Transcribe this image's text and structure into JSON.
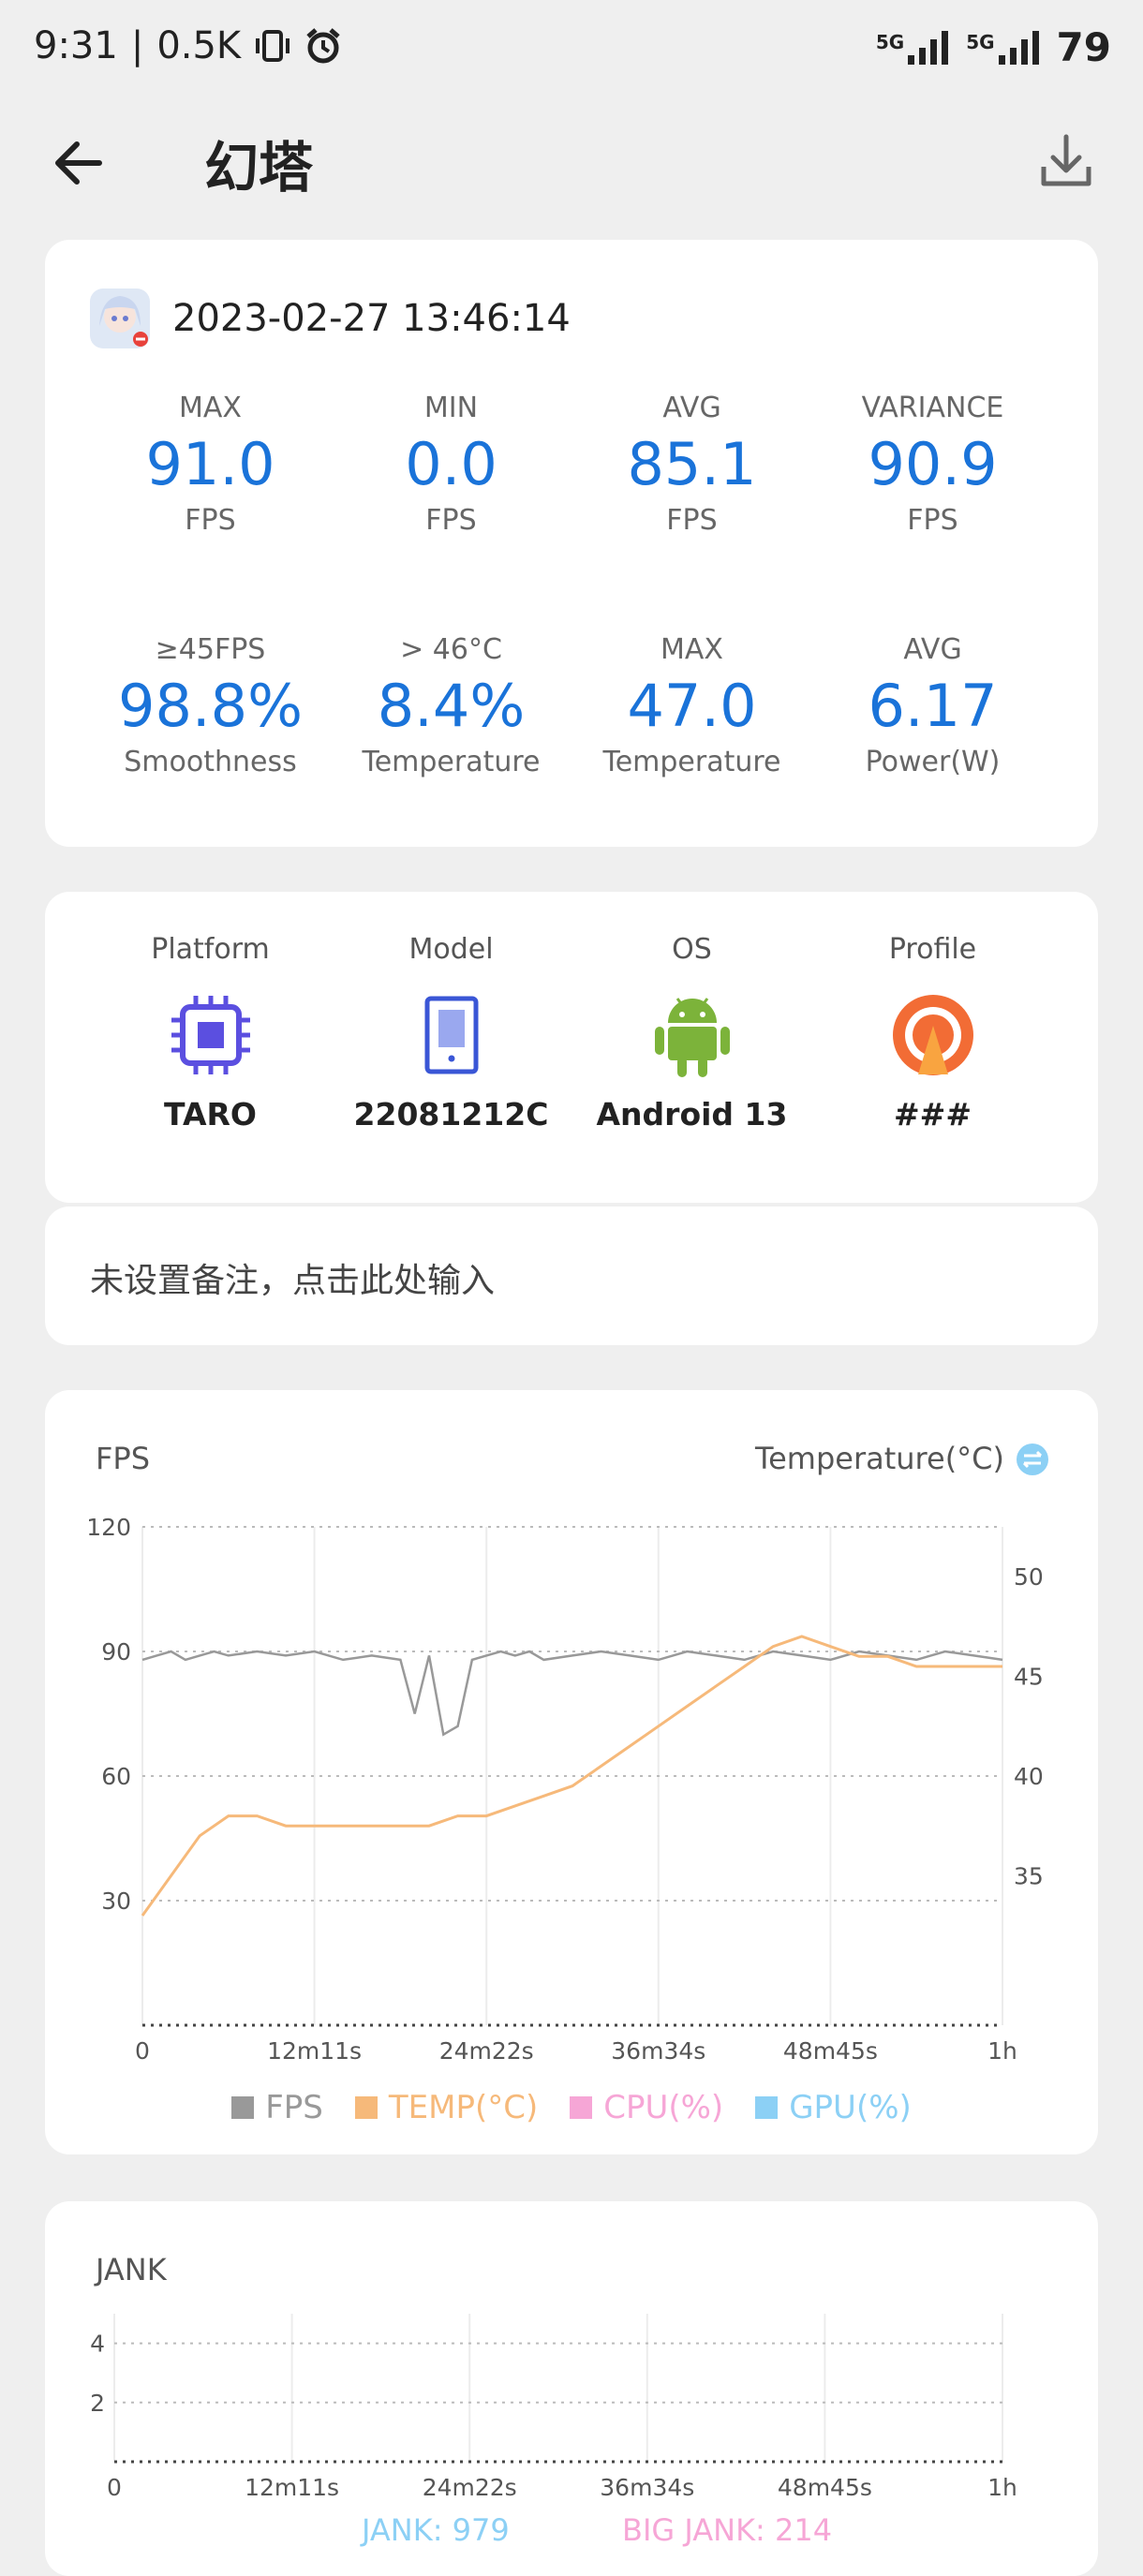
{
  "status": {
    "time": "9:31",
    "speed": "0.5K",
    "signal1": "5G",
    "signal2": "5G",
    "battery": "79"
  },
  "appbar": {
    "title": "幻塔"
  },
  "session": {
    "timestamp": "2023-02-27 13:46:14"
  },
  "stats": [
    {
      "label": "MAX",
      "value": "91.0",
      "unit": "FPS"
    },
    {
      "label": "MIN",
      "value": "0.0",
      "unit": "FPS"
    },
    {
      "label": "AVG",
      "value": "85.1",
      "unit": "FPS"
    },
    {
      "label": "VARIANCE",
      "value": "90.9",
      "unit": "FPS"
    },
    {
      "label": "≥45FPS",
      "value": "98.8%",
      "unit": "Smoothness"
    },
    {
      "label": "> 46°C",
      "value": "8.4%",
      "unit": "Temperature"
    },
    {
      "label": "MAX",
      "value": "47.0",
      "unit": "Temperature"
    },
    {
      "label": "AVG",
      "value": "6.17",
      "unit": "Power(W)"
    }
  ],
  "device": [
    {
      "label": "Platform",
      "value": "TARO",
      "icon": "chip-icon"
    },
    {
      "label": "Model",
      "value": "22081212C",
      "icon": "phone-icon"
    },
    {
      "label": "OS",
      "value": "Android 13",
      "icon": "android-icon"
    },
    {
      "label": "Profile",
      "value": "###",
      "icon": "profile-icon"
    }
  ],
  "note": {
    "placeholder": "未设置备注，点击此处输入"
  },
  "colors": {
    "accent": "#1a73d9",
    "fps": "#999999",
    "temp": "#f6b97a",
    "cpu": "#f6a6d6",
    "gpu": "#8cd0f5"
  },
  "fps_chart": {
    "title": "FPS",
    "right_title": "Temperature(°C)",
    "legend": [
      "FPS",
      "TEMP(°C)",
      "CPU(%)",
      "GPU(%)"
    ]
  },
  "jank_chart": {
    "title": "JANK",
    "jank_label": "JANK: 979",
    "big_jank_label": "BIG JANK: 214"
  },
  "chart_data": [
    {
      "type": "line",
      "title": "FPS",
      "xlabel": "",
      "ylabel": "FPS",
      "x_ticks": [
        "0",
        "12m11s",
        "24m22s",
        "36m34s",
        "48m45s",
        "1h"
      ],
      "xlim_minutes": [
        0,
        60
      ],
      "ylim": [
        0,
        120
      ],
      "y_ticks": [
        30,
        60,
        90,
        120
      ],
      "y2_label": "Temperature(°C)",
      "y2_ticks": [
        35,
        40,
        45,
        50
      ],
      "grid": true,
      "legend_position": "bottom",
      "series": [
        {
          "name": "FPS",
          "axis": "left",
          "x": [
            0,
            1,
            2,
            3,
            4,
            5,
            6,
            8,
            10,
            12,
            14,
            16,
            18,
            19,
            20,
            21,
            22,
            23,
            24,
            25,
            26,
            27,
            28,
            30,
            32,
            34,
            36,
            38,
            40,
            42,
            44,
            46,
            48,
            50,
            52,
            54,
            56,
            58,
            60
          ],
          "y": [
            88,
            89,
            90,
            88,
            89,
            90,
            89,
            90,
            89,
            90,
            88,
            89,
            88,
            75,
            89,
            70,
            72,
            88,
            89,
            90,
            89,
            90,
            88,
            89,
            90,
            89,
            88,
            90,
            89,
            88,
            90,
            89,
            88,
            90,
            89,
            88,
            90,
            89,
            88
          ]
        },
        {
          "name": "TEMP(°C)",
          "axis": "right",
          "x": [
            0,
            2,
            4,
            6,
            8,
            10,
            12,
            14,
            16,
            18,
            20,
            22,
            24,
            26,
            28,
            30,
            32,
            34,
            36,
            38,
            40,
            42,
            44,
            46,
            48,
            50,
            52,
            54,
            56,
            58,
            60
          ],
          "y": [
            33,
            35,
            37,
            38,
            38,
            37.5,
            37.5,
            37.5,
            37.5,
            37.5,
            37.5,
            38,
            38,
            38.5,
            39,
            39.5,
            40.5,
            41.5,
            42.5,
            43.5,
            44.5,
            45.5,
            46.5,
            47,
            46.5,
            46,
            46,
            45.5,
            45.5,
            45.5,
            45.5
          ]
        }
      ]
    },
    {
      "type": "bar",
      "title": "JANK",
      "x_ticks": [
        "0",
        "12m11s",
        "24m22s",
        "36m34s",
        "48m45s",
        "1h"
      ],
      "ylim": [
        0,
        5
      ],
      "y_ticks": [
        2,
        4
      ],
      "series": [
        {
          "name": "JANK: 979"
        },
        {
          "name": "BIG JANK: 214"
        }
      ]
    }
  ]
}
